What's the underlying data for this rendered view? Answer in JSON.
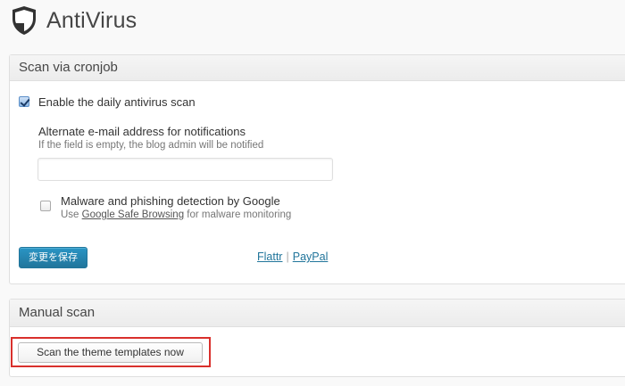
{
  "header": {
    "title": "AntiVirus",
    "logo_icon": "shield-icon"
  },
  "cronjob_box": {
    "title": "Scan via cronjob",
    "daily_scan": {
      "label": "Enable the daily antivirus scan",
      "checked": true
    },
    "email": {
      "label": "Alternate e-mail address for notifications",
      "hint": "If the field is empty, the blog admin will be notified",
      "value": "",
      "placeholder": ""
    },
    "google": {
      "label": "Malware and phishing detection by Google",
      "hint_prefix": "Use ",
      "hint_link": "Google Safe Browsing",
      "hint_suffix": " for malware monitoring",
      "checked": false
    },
    "save_label": "変更を保存",
    "links": {
      "flattr": "Flattr",
      "separator": "|",
      "paypal": "PayPal"
    }
  },
  "manual_box": {
    "title": "Manual scan",
    "scan_label": "Scan the theme templates now"
  },
  "colors": {
    "primary": "#21759b",
    "highlight": "#d9302c"
  }
}
